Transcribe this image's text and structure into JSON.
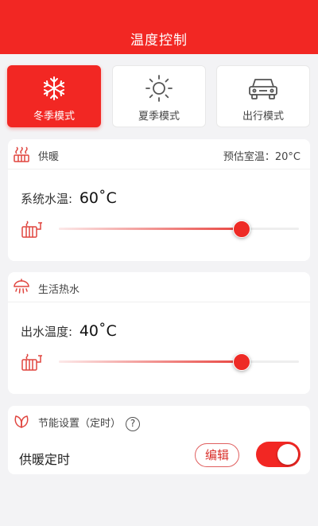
{
  "header": {
    "title": "温度控制"
  },
  "modes": [
    {
      "label": "冬季模式",
      "icon": "snowflake-icon",
      "active": true
    },
    {
      "label": "夏季模式",
      "icon": "sun-icon",
      "active": false
    },
    {
      "label": "出行模式",
      "icon": "car-icon",
      "active": false
    }
  ],
  "heating": {
    "title": "供暖",
    "estimate_label": "预估室温：20°C",
    "water_temp_label": "系统水温:",
    "water_temp_value": "60˚C",
    "slider_fraction": 0.76
  },
  "hot_water": {
    "title": "生活热水",
    "outlet_temp_label": "出水温度:",
    "outlet_temp_value": "40˚C",
    "slider_fraction": 0.76
  },
  "energy": {
    "title": "节能设置（定时）",
    "help_icon": "?",
    "schedule_label": "供暖定时",
    "edit_label": "编辑",
    "toggle_on": true
  },
  "colors": {
    "accent": "#f22723",
    "text": "#333333",
    "background": "#f3f3f5"
  }
}
